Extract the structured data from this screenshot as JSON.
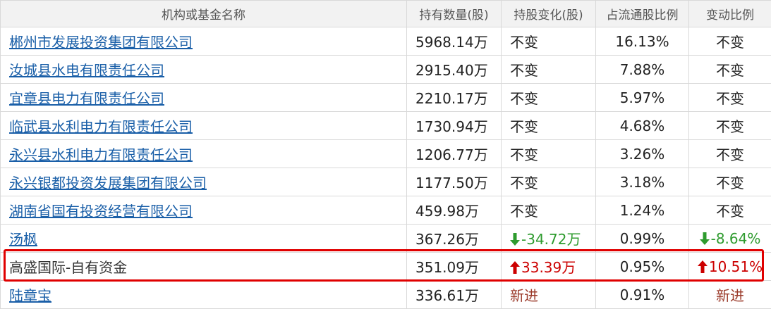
{
  "headers": [
    "机构或基金名称",
    "持有数量(股)",
    "持股变化(股)",
    "占流通股比例",
    "变动比例"
  ],
  "rows": [
    {
      "name": "郴州市发展投资集团有限公司",
      "linked": true,
      "holding": "5968.14万",
      "change": "不变",
      "change_dir": "neutral",
      "pct": "16.13%",
      "ratio": "不变",
      "ratio_dir": "neutral"
    },
    {
      "name": "汝城县水电有限责任公司",
      "linked": true,
      "holding": "2915.40万",
      "change": "不变",
      "change_dir": "neutral",
      "pct": "7.88%",
      "ratio": "不变",
      "ratio_dir": "neutral"
    },
    {
      "name": "宜章县电力有限责任公司",
      "linked": true,
      "holding": "2210.17万",
      "change": "不变",
      "change_dir": "neutral",
      "pct": "5.97%",
      "ratio": "不变",
      "ratio_dir": "neutral"
    },
    {
      "name": "临武县水利电力有限责任公司",
      "linked": true,
      "holding": "1730.94万",
      "change": "不变",
      "change_dir": "neutral",
      "pct": "4.68%",
      "ratio": "不变",
      "ratio_dir": "neutral"
    },
    {
      "name": "永兴县水利电力有限责任公司",
      "linked": true,
      "holding": "1206.77万",
      "change": "不变",
      "change_dir": "neutral",
      "pct": "3.26%",
      "ratio": "不变",
      "ratio_dir": "neutral"
    },
    {
      "name": "永兴银都投资发展集团有限公司",
      "linked": true,
      "holding": "1177.50万",
      "change": "不变",
      "change_dir": "neutral",
      "pct": "3.18%",
      "ratio": "不变",
      "ratio_dir": "neutral"
    },
    {
      "name": "湖南省国有投资经营有限公司",
      "linked": true,
      "holding": "459.98万",
      "change": "不变",
      "change_dir": "neutral",
      "pct": "1.24%",
      "ratio": "不变",
      "ratio_dir": "neutral"
    },
    {
      "name": "汤枫",
      "linked": true,
      "holding": "367.26万",
      "change": "-34.72万",
      "change_dir": "down",
      "pct": "0.99%",
      "ratio": "-8.64%",
      "ratio_dir": "down"
    },
    {
      "name": "高盛国际-自有资金",
      "linked": false,
      "holding": "351.09万",
      "change": "33.39万",
      "change_dir": "up",
      "pct": "0.95%",
      "ratio": "10.51%",
      "ratio_dir": "up"
    },
    {
      "name": "陆章宝",
      "linked": true,
      "holding": "336.61万",
      "change": "新进",
      "change_dir": "new",
      "pct": "0.91%",
      "ratio": "新进",
      "ratio_dir": "new"
    }
  ],
  "colors": {
    "link": "#1a5fa8",
    "up": "#cc0000",
    "down": "#2e9b2e",
    "highlight": "#e00000",
    "header_bg": "#f2f2f2"
  },
  "icons": {
    "up": "arrow-up-icon",
    "down": "arrow-down-icon"
  }
}
